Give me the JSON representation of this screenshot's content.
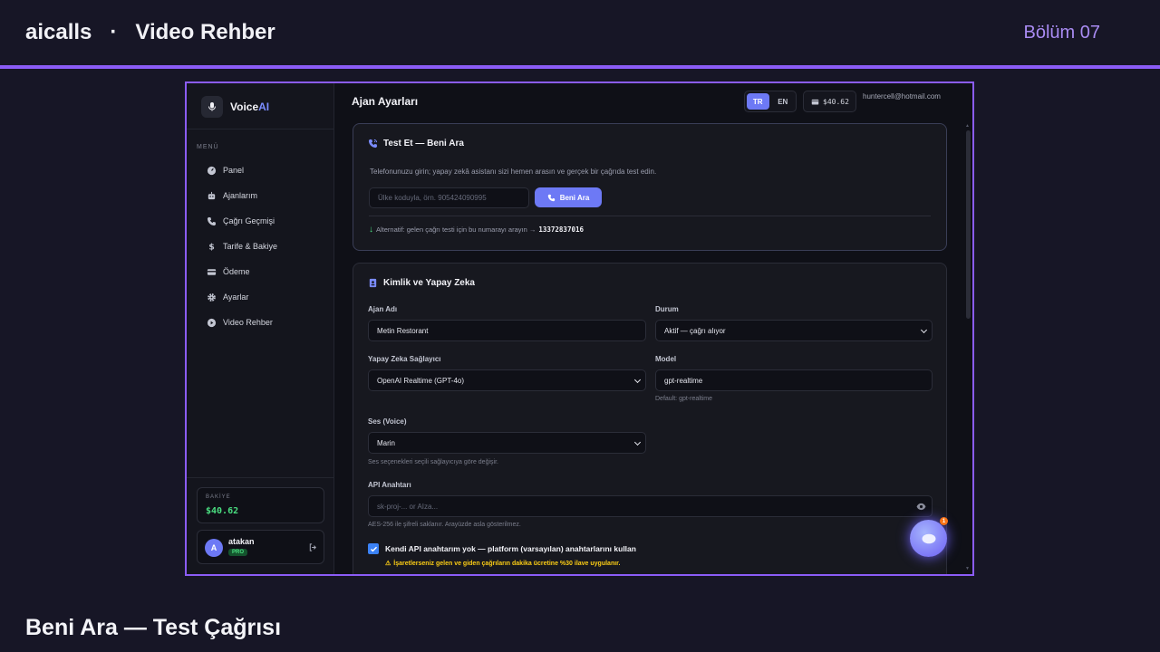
{
  "video": {
    "title": "aicalls   ·   Video Rehber",
    "episode": "Bölüm 07",
    "footer_title": "Beni Ara — Test Çağrısı"
  },
  "sidebar": {
    "brand_prefix": "Voice",
    "brand_suffix": "AI",
    "menu_label": "MENÜ",
    "items": [
      {
        "label": "Panel",
        "icon": "gauge-icon"
      },
      {
        "label": "Ajanlarım",
        "icon": "robot-icon"
      },
      {
        "label": "Çağrı Geçmişi",
        "icon": "phone-icon"
      },
      {
        "label": "Tarife & Bakiye",
        "icon": "dollar-icon"
      },
      {
        "label": "Ödeme",
        "icon": "credit-card-icon"
      },
      {
        "label": "Ayarlar",
        "icon": "gear-icon"
      },
      {
        "label": "Video Rehber",
        "icon": "play-icon"
      }
    ],
    "balance_label": "BAKİYE",
    "balance_value": "$40.62",
    "user_initial": "A",
    "user_name": "atakan",
    "user_plan": "PRO"
  },
  "topbar": {
    "title": "Ajan Ayarları",
    "lang_tr": "TR",
    "lang_en": "EN",
    "wallet": "$40.62",
    "email": "huntercell@hotmail.com"
  },
  "test_card": {
    "title": "Test Et — Beni Ara",
    "description": "Telefonunuzu girin; yapay zekâ asistanı sizi hemen arasın ve gerçek bir çağrıda test edin.",
    "phone_placeholder": "Ülke koduyla, örn. 905424090995",
    "call_button": "Beni Ara",
    "alt_text": "Alternatif: gelen çağrı testi için bu numarayı arayın →",
    "alt_number": "13372837016"
  },
  "identity_card": {
    "title": "Kimlik ve Yapay Zeka",
    "agent_name_label": "Ajan Adı",
    "agent_name_value": "Metin Restorant",
    "status_label": "Durum",
    "status_value": "Aktif — çağrı alıyor",
    "provider_label": "Yapay Zeka Sağlayıcı",
    "provider_value": "OpenAI Realtime (GPT-4o)",
    "model_label": "Model",
    "model_value": "gpt-realtime",
    "model_help": "Default: gpt-realtime",
    "voice_label": "Ses (Voice)",
    "voice_value": "Marin",
    "voice_help": "Ses seçenekleri seçili sağlayıcıya göre değişir.",
    "api_label": "API Anahtarı",
    "api_placeholder": "sk-proj-... or AIza...",
    "api_help": "AES-256 ile şifreli saklanır. Arayüzde asla gösterilmez.",
    "checkbox_label": "Kendi API anahtarım yok — platform (varsayılan) anahtarlarını kullan",
    "warning": "İşaretlerseniz gelen ve giden çağrıların dakika ücretine %30 ilave uygulanır."
  },
  "fab": {
    "badge": "1"
  },
  "colors": {
    "accent": "#8b5cf6",
    "primary": "#6d79f5",
    "success": "#4ade80",
    "warning": "#facc15"
  }
}
